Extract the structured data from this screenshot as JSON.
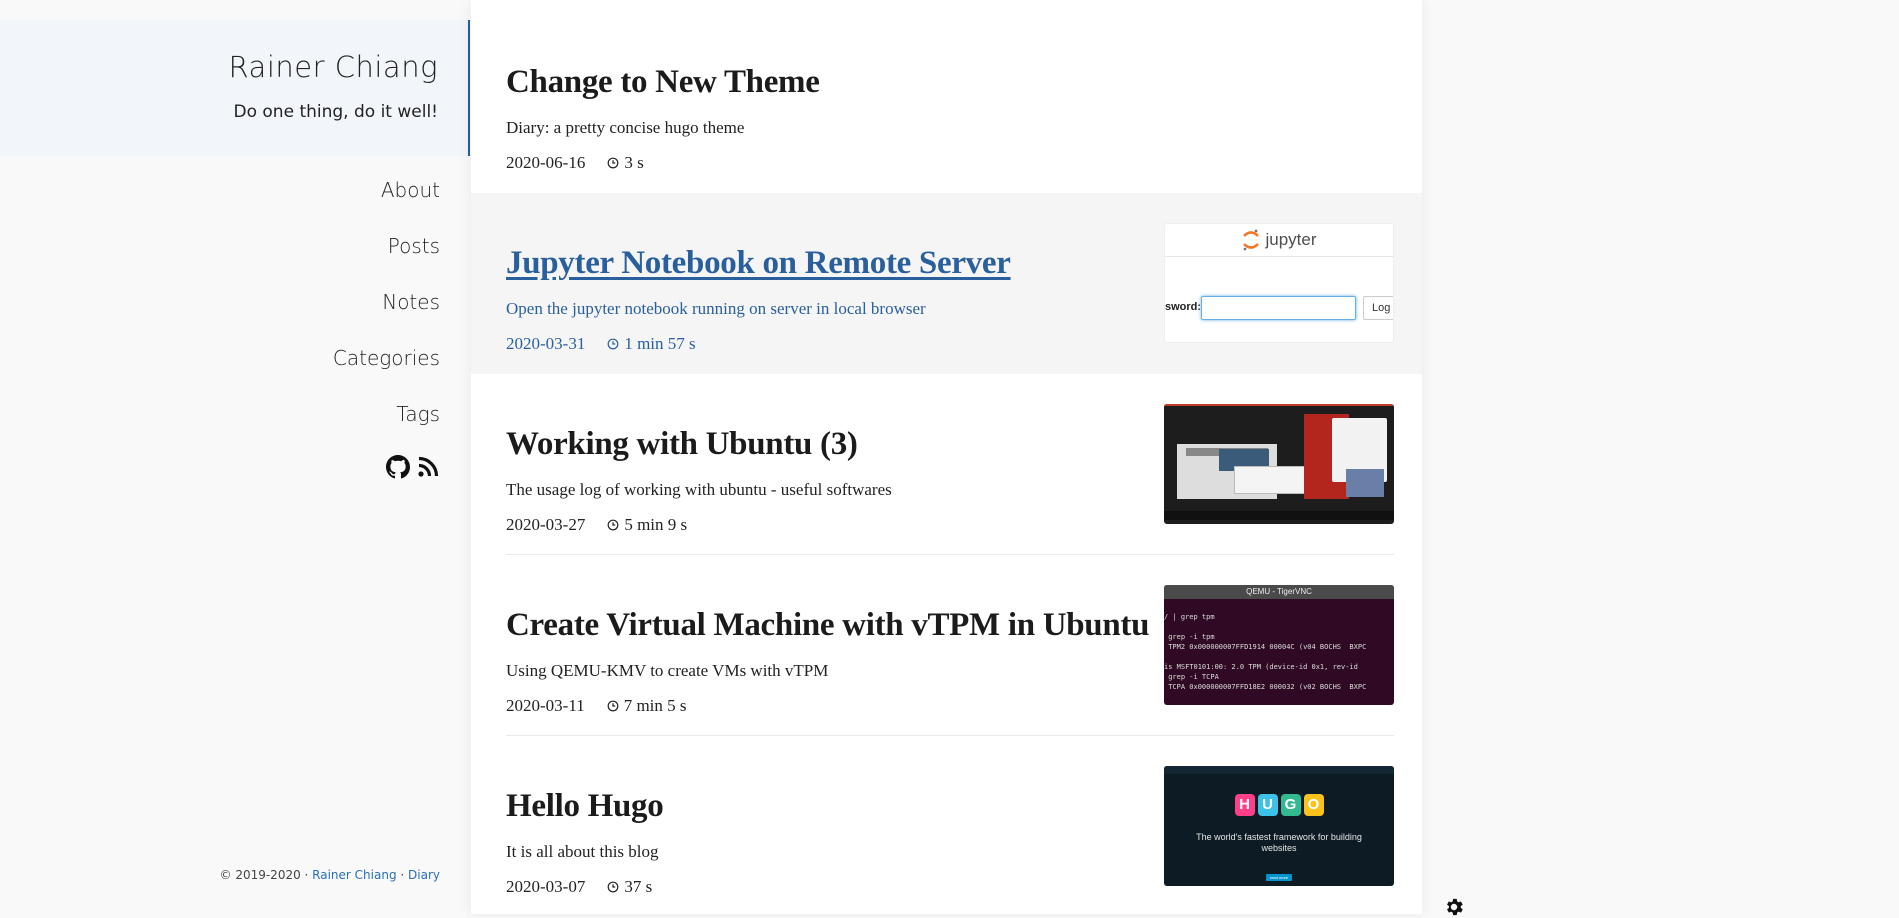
{
  "site": {
    "title": "Rainer Chiang",
    "subtitle": "Do one thing, do it well!"
  },
  "nav": [
    {
      "label": "About"
    },
    {
      "label": "Posts"
    },
    {
      "label": "Notes"
    },
    {
      "label": "Categories"
    },
    {
      "label": "Tags"
    }
  ],
  "social": [
    {
      "icon": "github-icon"
    },
    {
      "icon": "rss-icon"
    }
  ],
  "footer": {
    "copyright": "© 2019-2020 · ",
    "author_link": "Rainer Chiang",
    "separator": " · ",
    "theme_link": "Diary"
  },
  "posts": [
    {
      "title": "Change to New Theme",
      "summary": "Diary: a pretty concise hugo theme",
      "date": "2020-06-16",
      "reading_time": "3 s",
      "thumbnail": null
    },
    {
      "title": "Jupyter Notebook on Remote Server",
      "summary": "Open the jupyter notebook running on server in local browser",
      "date": "2020-03-31",
      "reading_time": "1 min 57 s",
      "thumbnail": {
        "kind": "jupyter-login",
        "logo_text": "jupyter",
        "field_label": "sword:",
        "button_label": "Log i"
      }
    },
    {
      "title": "Working with Ubuntu (3)",
      "summary": "The usage log of working with ubuntu - useful softwares",
      "date": "2020-03-27",
      "reading_time": "5 min 9 s",
      "thumbnail": {
        "kind": "ubuntu-desktop"
      }
    },
    {
      "title": "Create Virtual Machine with vTPM in Ubuntu",
      "summary": "Using QEMU-KMV to create VMs with vTPM",
      "date": "2020-03-11",
      "reading_time": "7 min 5 s",
      "thumbnail": {
        "kind": "terminal",
        "window_title": "QEMU - TigerVNC",
        "lines": [
          "/ | grep tpm",
          "",
          " grep -i tpm",
          " TPM2 0x000000007FFD1914 00004C (v04 BOCHS  BXPC",
          "",
          "is MSFT0101:00: 2.0 TPM (device-id 0x1, rev-id",
          " grep -i TCPA",
          " TCPA 0x000000007FFD18E2 000032 (v02 BOCHS  BXPC"
        ]
      }
    },
    {
      "title": "Hello Hugo",
      "summary": "It is all about this blog",
      "date": "2020-03-07",
      "reading_time": "37 s",
      "thumbnail": {
        "kind": "hugo-site",
        "letters": [
          "H",
          "U",
          "G",
          "O"
        ],
        "tagline": "The world's fastest framework for building websites",
        "button_label": "read more"
      }
    }
  ],
  "colors": {
    "accent": "#2a5f9e",
    "link": "#2a6fb6",
    "sidebar_head_bg": "#f2f6fa",
    "active_post_bg": "#f5f5f5"
  }
}
